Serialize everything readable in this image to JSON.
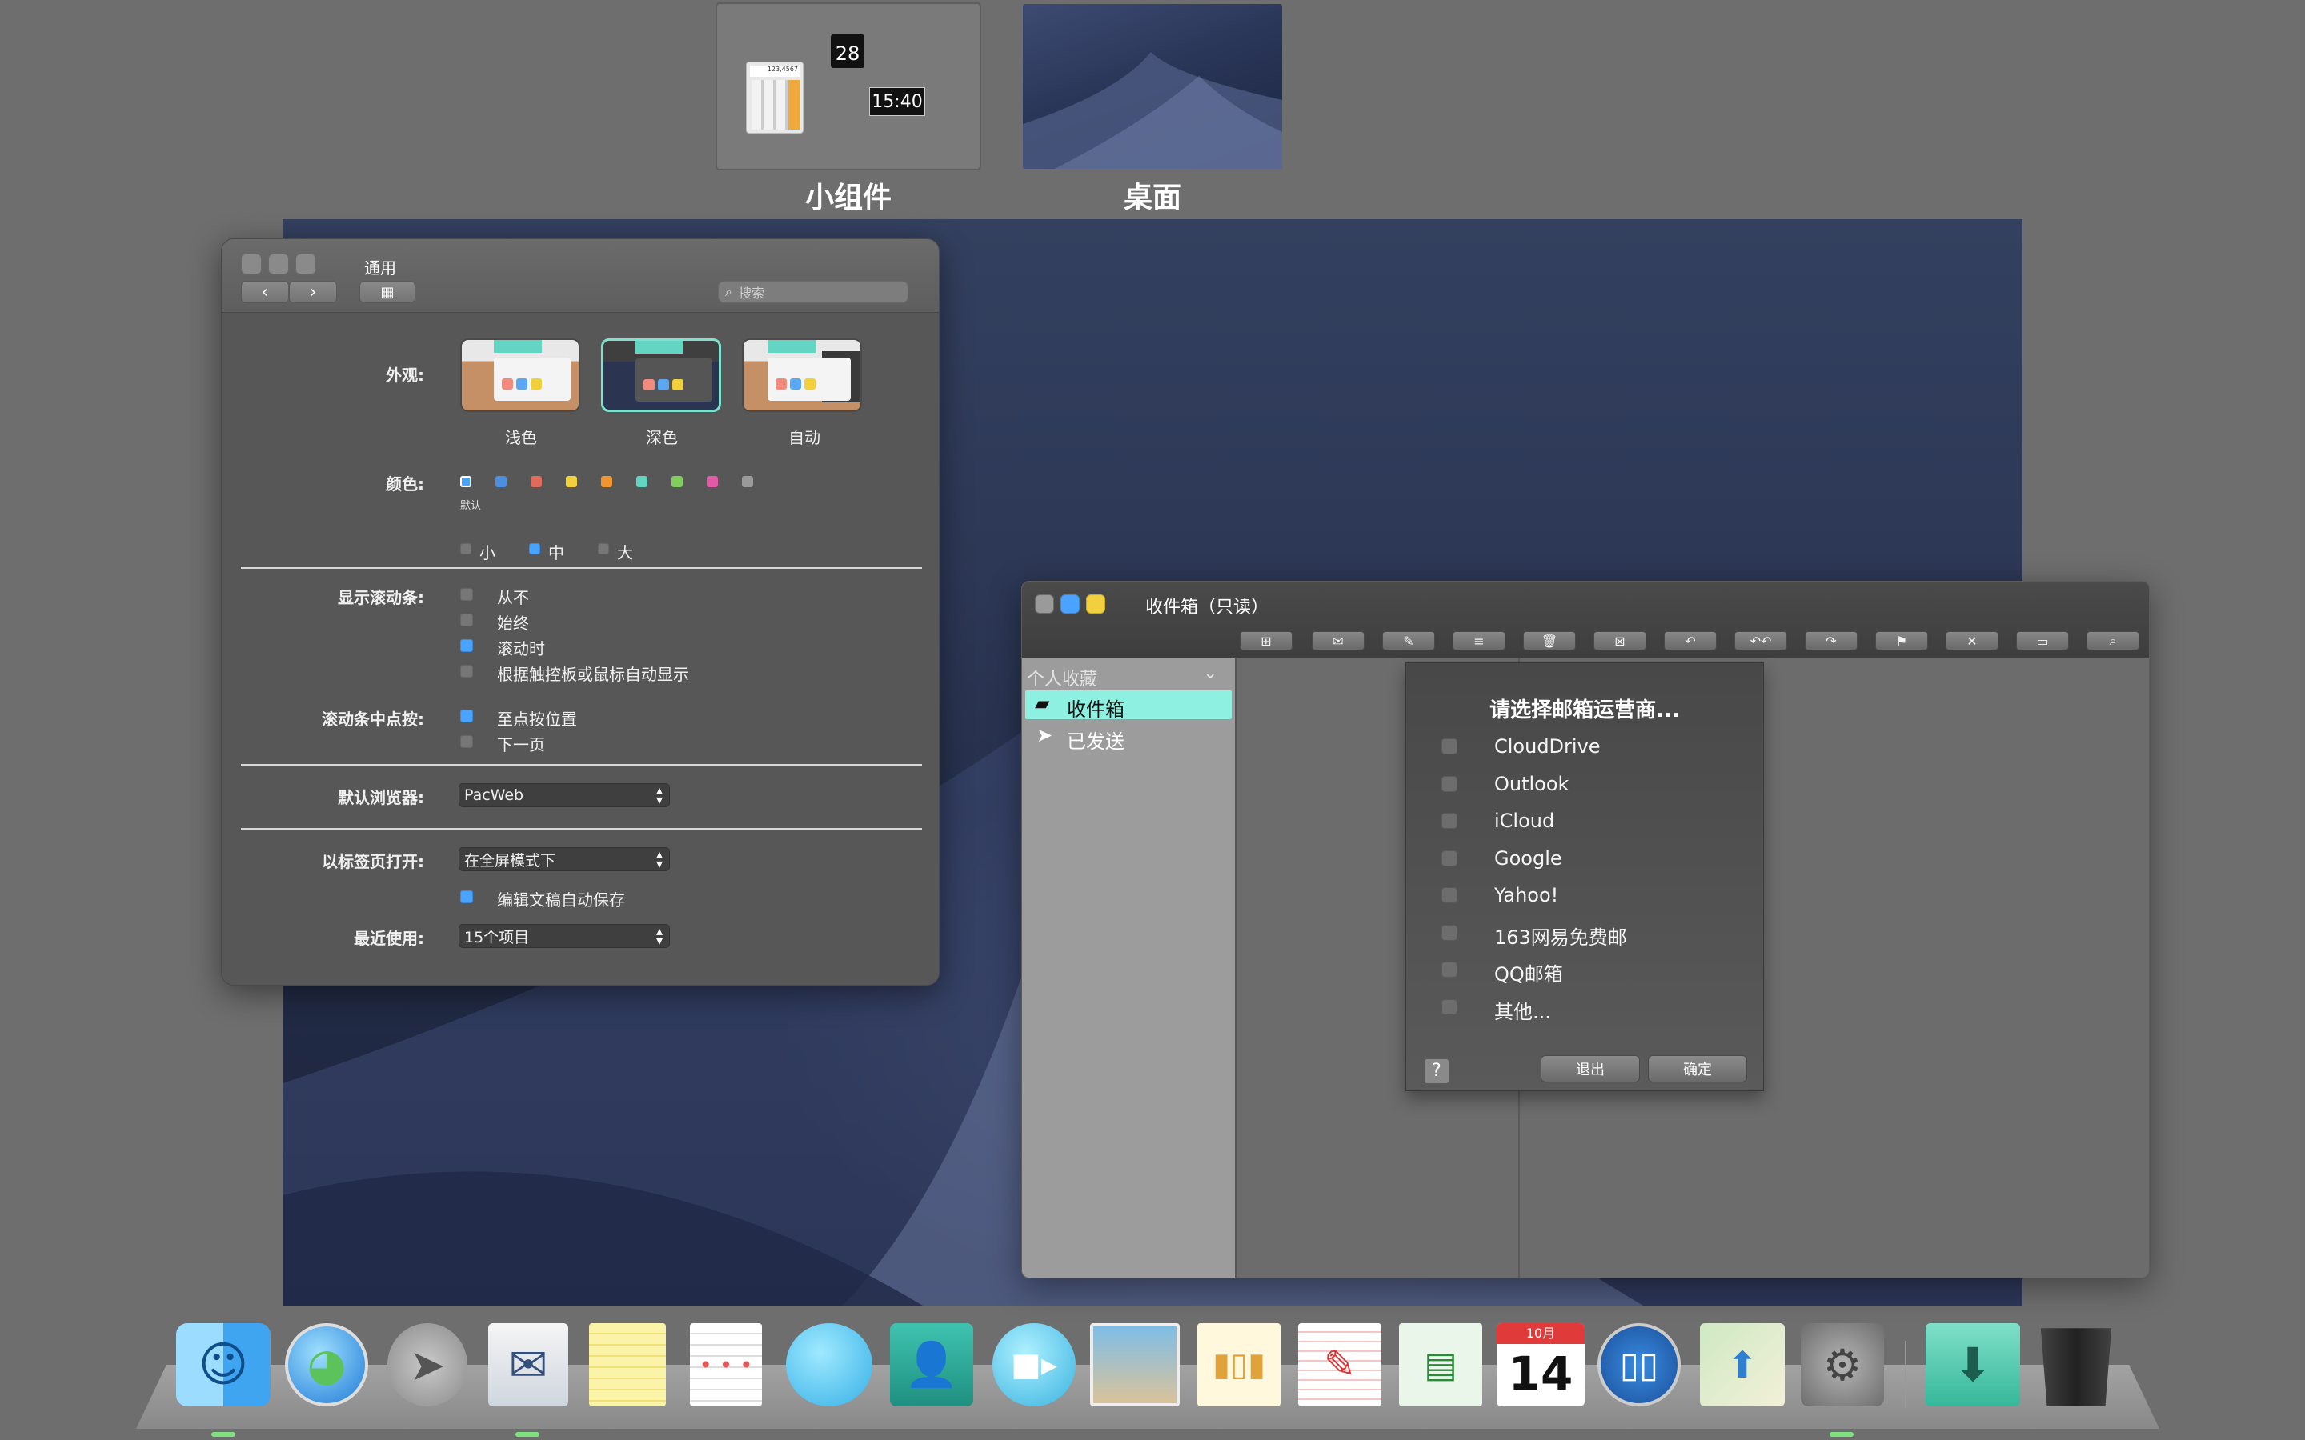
{
  "spaces": [
    {
      "label": "小组件",
      "calendar_day": "28",
      "clock": "15:40",
      "calc_display": "123,4567"
    },
    {
      "label": "桌面"
    }
  ],
  "prefs": {
    "title": "通用",
    "search_placeholder": "搜索",
    "appearance_label": "外观:",
    "themes": [
      "浅色",
      "深色",
      "自动"
    ],
    "color_label": "颜色:",
    "color_default": "默认",
    "swatch_colors": [
      "#4aa3ff",
      "#4a8fe0",
      "#e06b5a",
      "#f2cf3c",
      "#f0962f",
      "#62d6c3",
      "#7fcf5a",
      "#e05aa8",
      "#9a9a9a"
    ],
    "sizes": [
      "小",
      "中",
      "大"
    ],
    "scrollbars_label": "显示滚动条:",
    "scrollbar_options": [
      "从不",
      "始终",
      "滚动时",
      "根据触控板或鼠标自动显示"
    ],
    "click_label": "滚动条中点按:",
    "click_options": [
      "至点按位置",
      "下一页"
    ],
    "browser_label": "默认浏览器:",
    "browser_value": "PacWeb",
    "tabs_label": "以标签页打开:",
    "tabs_value": "在全屏模式下",
    "autosave_label": "编辑文稿自动保存",
    "recent_label": "最近使用:",
    "recent_value": "15个项目"
  },
  "mail": {
    "title": "收件箱（只读）",
    "favorites": "个人收藏",
    "inbox": "收件箱",
    "sent": "已发送",
    "sheet": {
      "title": "请选择邮箱运营商...",
      "providers": [
        "CloudDrive",
        "Outlook",
        "iCloud",
        "Google",
        "Yahoo!",
        "163网易免费邮",
        "QQ邮箱",
        "其他..."
      ],
      "help": "?",
      "quit": "退出",
      "ok": "确定"
    }
  },
  "dock": {
    "calendar_month": "10月",
    "calendar_day": "14",
    "items": [
      "finder",
      "browser",
      "send",
      "mail",
      "notes",
      "reminders",
      "messages",
      "contacts",
      "facetime",
      "photos",
      "speech",
      "note",
      "table",
      "calendar",
      "sidecar",
      "maps",
      "system-preferences",
      "downloads",
      "trash"
    ]
  },
  "colors": {
    "accent": "#4aa3ff",
    "selection": "#8ef0e0"
  }
}
